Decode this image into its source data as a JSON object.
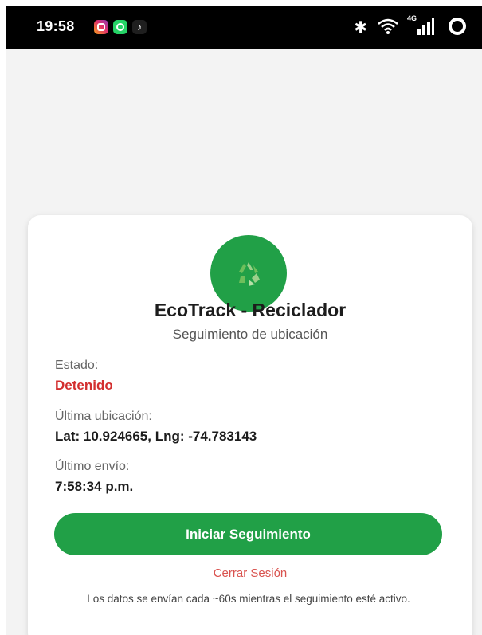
{
  "status_bar": {
    "time": "19:58",
    "network_label": "4G",
    "icons": [
      "instagram-icon",
      "whatsapp-icon",
      "tiktok-icon",
      "bluetooth-icon",
      "wifi-icon",
      "signal-icon",
      "battery-icon"
    ]
  },
  "app": {
    "title": "EcoTrack - Reciclador",
    "subtitle": "Seguimiento de ubicación",
    "logo_icon": "recycle-icon",
    "accent_color": "#21a047"
  },
  "info": {
    "estado_label": "Estado:",
    "estado_value": "Detenido",
    "estado_color": "#d32f2f",
    "ubicacion_label": "Última ubicación:",
    "ubicacion_value": "Lat: 10.924665, Lng: -74.783143",
    "envio_label": "Último envío:",
    "envio_value": "7:58:34 p.m."
  },
  "actions": {
    "start_label": "Iniciar Seguimiento",
    "logout_label": "Cerrar Sesión"
  },
  "footer": {
    "note": "Los datos se envían cada ~60s mientras el seguimiento esté activo."
  }
}
